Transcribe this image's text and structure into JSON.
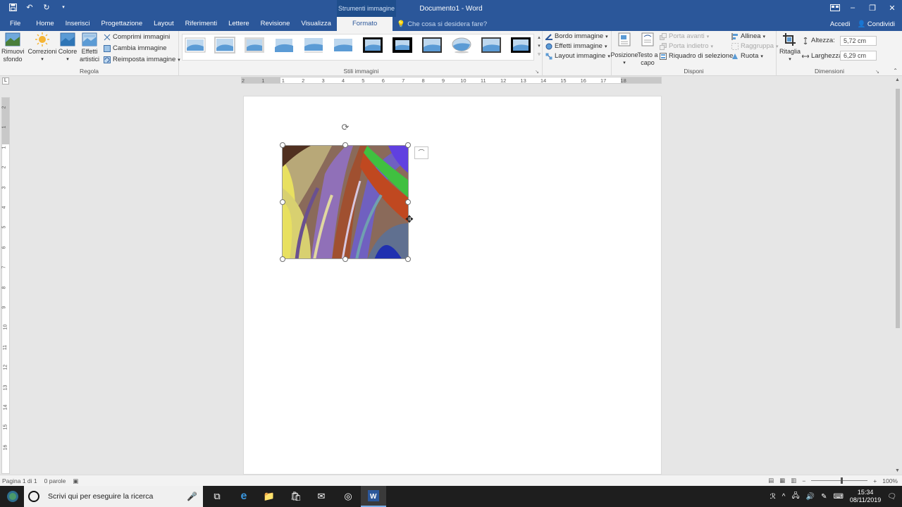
{
  "window": {
    "doc_title": "Documento1 - Word",
    "context_header": "Strumenti immagine"
  },
  "tabs": {
    "file": "File",
    "home": "Home",
    "insert": "Inserisci",
    "design": "Progettazione",
    "layout": "Layout",
    "references": "Riferimenti",
    "mailings": "Lettere",
    "review": "Revisione",
    "view": "Visualizza",
    "format": "Formato",
    "tellme": "Che cosa si desidera fare?",
    "signin": "Accedi",
    "share": "Condividi"
  },
  "ribbon": {
    "adjust": {
      "label": "Regola",
      "remove_bg_1": "Rimuovi",
      "remove_bg_2": "sfondo",
      "corrections": "Correzioni",
      "color": "Colore",
      "artistic_1": "Effetti",
      "artistic_2": "artistici",
      "compress": "Comprimi immagini",
      "change": "Cambia immagine",
      "reset": "Reimposta immagine"
    },
    "styles": {
      "label": "Stili immagini"
    },
    "picture_fx": {
      "border": "Bordo immagine",
      "effects": "Effetti immagine",
      "layout": "Layout immagine"
    },
    "arrange": {
      "label": "Disponi",
      "position": "Posizione",
      "wrap_1": "Testo a",
      "wrap_2": "capo",
      "forward": "Porta avanti",
      "backward": "Porta indietro",
      "selection_pane": "Riquadro di selezione",
      "align": "Allinea",
      "group": "Raggruppa",
      "rotate": "Ruota"
    },
    "size": {
      "label": "Dimensioni",
      "crop": "Ritaglia",
      "height_label": "Altezza:",
      "height_value": "5,72 cm",
      "width_label": "Larghezza:",
      "width_value": "6,29 cm"
    }
  },
  "ruler": {
    "h_numbers": [
      "2",
      "1",
      "1",
      "2",
      "3",
      "4",
      "5",
      "6",
      "7",
      "8",
      "9",
      "10",
      "11",
      "12",
      "13",
      "14",
      "15",
      "16",
      "17",
      "18"
    ],
    "v_numbers": [
      "2",
      "1",
      "1",
      "2",
      "3",
      "4",
      "5",
      "6",
      "7",
      "8",
      "9",
      "10",
      "11",
      "12",
      "13",
      "14",
      "15",
      "16"
    ]
  },
  "status": {
    "page": "Pagina 1 di 1",
    "words": "0 parole",
    "zoom": "100%"
  },
  "taskbar": {
    "search_placeholder": "Scrivi qui per eseguire la ricerca",
    "time": "15:34",
    "date": "08/11/2019"
  },
  "icons": {
    "save": "save-icon",
    "undo": "undo-icon",
    "redo": "redo-icon",
    "rotate_handle": "rotate-handle-icon",
    "layout_options": "layout-options-icon",
    "move_cursor": "move-cursor-icon"
  },
  "colors": {
    "accent": "#2b579a",
    "ribbon": "#f3f3f3",
    "taskbar": "#1e1e1e"
  }
}
